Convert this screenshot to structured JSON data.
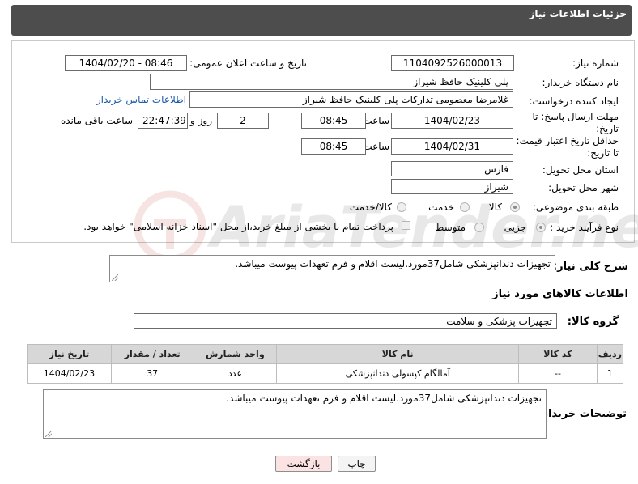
{
  "header": {
    "title": "جزئیات اطلاعات نیاز"
  },
  "form": {
    "need_number_label": "شماره نیاز:",
    "need_number": "1104092526000013",
    "announce_label": "تاریخ و ساعت اعلان عمومی:",
    "announce_value": "1404/02/20 - 08:46",
    "buyer_org_label": "نام دستگاه خریدار:",
    "buyer_org": "پلی کلینیک حافظ شیراز",
    "creator_label": "ایجاد کننده درخواست:",
    "creator": "غلامرضا معصومی تدارکات پلی کلینیک حافظ شیراز",
    "contact_link": "اطلاعات تماس خریدار",
    "deadline_label_1": "مهلت ارسال پاسخ: تا",
    "deadline_label_2": "تاریخ:",
    "deadline_date": "1404/02/23",
    "time_label": "ساعت",
    "deadline_time": "08:45",
    "days_value": "2",
    "days_label": "روز و",
    "remaining_time": "22:47:39",
    "remaining_label": "ساعت باقی مانده",
    "validity_label_1": "حداقل تاریخ اعتبار قیمت:",
    "validity_label_2": "تا تاریخ:",
    "validity_date": "1404/02/31",
    "validity_time": "08:45",
    "province_label": "استان محل تحویل:",
    "province": "فارس",
    "city_label": "شهر محل تحویل:",
    "city": "شیراز",
    "category_label": "طبقه بندی موضوعی:",
    "category_options": [
      "کالا",
      "خدمت",
      "کالا/خدمت"
    ],
    "process_label": "نوع فرآیند خرید :",
    "process_options": [
      "جزیی",
      "متوسط"
    ],
    "payment_note": "پرداخت تمام یا بخشی از مبلغ خرید،از محل \"اسناد خزانه اسلامی\" خواهد بود."
  },
  "description": {
    "label": "شرح کلی نیاز:",
    "text": "تجهیزات دندانپزشکی شامل37مورد.لیست اقلام و فرم تعهدات پیوست میباشد."
  },
  "goods": {
    "section_title": "اطلاعات کالاهای مورد نیاز",
    "group_label": "گروه کالا:",
    "group_value": "تجهیزات پزشکی و سلامت",
    "columns": [
      "ردیف",
      "کد کالا",
      "نام کالا",
      "واحد شمارش",
      "تعداد / مقدار",
      "تاریخ نیاز"
    ],
    "rows": [
      {
        "row": "1",
        "code": "--",
        "name": "آمالگام کپسولی دندانپزشکی",
        "unit": "عدد",
        "qty": "37",
        "date": "1404/02/23"
      }
    ]
  },
  "buyer_notes": {
    "label": "توضیحات خریدار:",
    "text": "تجهیزات دندانپزشکی شامل37مورد.لیست اقلام و فرم تعهدات پیوست میباشد."
  },
  "buttons": {
    "print": "چاپ",
    "back": "بازگشت"
  },
  "watermark": {
    "text": "AriaTender.neT"
  },
  "colors": {
    "header_bg": "#4d4d4d",
    "link": "#1a5aa6",
    "back_button_bg": "#fbe3e3",
    "table_header_bg": "#d7d7d7"
  }
}
